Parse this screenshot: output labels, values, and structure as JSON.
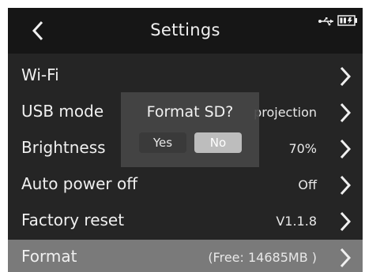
{
  "header": {
    "title": "Settings",
    "icons": [
      "back-icon",
      "usb-icon",
      "battery-icon"
    ]
  },
  "rows": [
    {
      "label": "Wi-Fi",
      "value": ""
    },
    {
      "label": "USB mode",
      "value": "projection"
    },
    {
      "label": "Brightness",
      "value": "70%"
    },
    {
      "label": "Auto power off",
      "value": "Off"
    },
    {
      "label": "Factory reset",
      "value": "V1.1.8"
    },
    {
      "label": "Format",
      "value": "(Free: 14685MB )"
    }
  ],
  "selected_row": "Format",
  "dialog": {
    "title": "Format SD?",
    "yes_label": "Yes",
    "no_label": "No",
    "focused_button": "No"
  },
  "colors": {
    "background": "#252525",
    "title_bar": "#161616",
    "selected_row": "#7a7a7a",
    "dialog": "#464646",
    "focused_button": "#bdbdbd"
  }
}
